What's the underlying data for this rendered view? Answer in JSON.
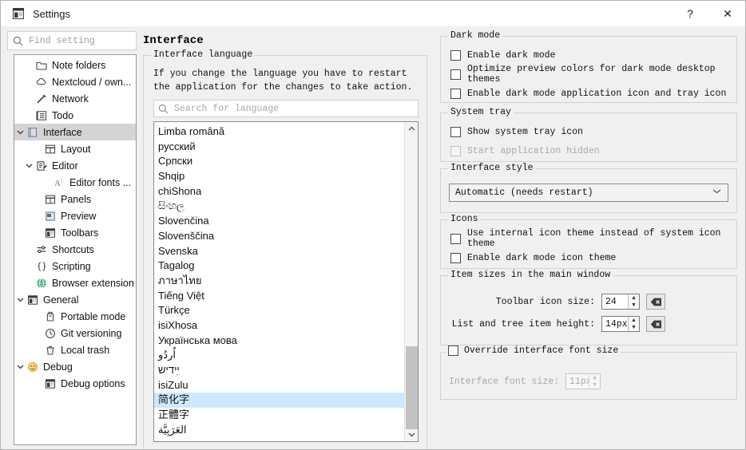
{
  "window": {
    "title": "Settings",
    "app_icon": "app-window-icon",
    "help_label": "?",
    "close_label": "✕"
  },
  "sidebar": {
    "search": {
      "placeholder": "Find setting",
      "value": "",
      "icon": "search-icon"
    },
    "items": [
      {
        "label": "Note folders",
        "icon": "folder-icon",
        "indent": 1,
        "expander": "",
        "selected": false
      },
      {
        "label": "Nextcloud / own...",
        "icon": "cloud-icon",
        "indent": 1,
        "expander": "",
        "selected": false
      },
      {
        "label": "Network",
        "icon": "network-icon",
        "indent": 1,
        "expander": "",
        "selected": false
      },
      {
        "label": "Todo",
        "icon": "todo-list-icon",
        "indent": 1,
        "expander": "",
        "selected": false
      },
      {
        "label": "Interface",
        "icon": "interface-icon",
        "indent": 0,
        "expander": "▾",
        "selected": true
      },
      {
        "label": "Layout",
        "icon": "layout-icon",
        "indent": 2,
        "expander": "",
        "selected": false
      },
      {
        "label": "Editor",
        "icon": "editor-icon",
        "indent": 1,
        "expander": "▾",
        "selected": false
      },
      {
        "label": "Editor fonts ...",
        "icon": "font-icon",
        "indent": 3,
        "expander": "",
        "selected": false
      },
      {
        "label": "Panels",
        "icon": "panels-icon",
        "indent": 2,
        "expander": "",
        "selected": false
      },
      {
        "label": "Preview",
        "icon": "preview-icon",
        "indent": 2,
        "expander": "",
        "selected": false
      },
      {
        "label": "Toolbars",
        "icon": "toolbars-icon",
        "indent": 2,
        "expander": "",
        "selected": false
      },
      {
        "label": "Shortcuts",
        "icon": "sliders-icon",
        "indent": 1,
        "expander": "",
        "selected": false
      },
      {
        "label": "Scripting",
        "icon": "braces-icon",
        "indent": 1,
        "expander": "",
        "selected": false
      },
      {
        "label": "Browser extension",
        "icon": "globe-icon",
        "indent": 1,
        "expander": "",
        "selected": false
      },
      {
        "label": "General",
        "icon": "general-icon",
        "indent": 0,
        "expander": "▾",
        "selected": false
      },
      {
        "label": "Portable mode",
        "icon": "usb-drive-icon",
        "indent": 2,
        "expander": "",
        "selected": false
      },
      {
        "label": "Git versioning",
        "icon": "clock-icon",
        "indent": 2,
        "expander": "",
        "selected": false
      },
      {
        "label": "Local trash",
        "icon": "trash-icon",
        "indent": 2,
        "expander": "",
        "selected": false
      },
      {
        "label": "Debug",
        "icon": "smiley-icon",
        "indent": 0,
        "expander": "▾",
        "selected": false
      },
      {
        "label": "Debug options",
        "icon": "debug-options-icon",
        "indent": 2,
        "expander": "",
        "selected": false
      }
    ]
  },
  "main": {
    "page_title": "Interface",
    "language_group": {
      "title": "Interface language",
      "note": "If you change the language you have to restart the application for the changes to take action.",
      "search": {
        "placeholder": "Search for language",
        "value": "",
        "icon": "search-icon"
      },
      "selected_language": "简化字",
      "scroll": {
        "up_arrow": "⌃",
        "down_arrow": "⌄"
      },
      "languages": [
        "Limba română",
        "русский",
        "Српски",
        "Shqip",
        "chiShona",
        "සිංහල",
        "Slovenčina",
        "Slovenščina",
        "Svenska",
        "Tagalog",
        "ภาษาไทย",
        "Tiếng Việt",
        "Türkçe",
        "isiXhosa",
        "Українська мова",
        "اُردُو",
        "ײִדיש",
        "isiZulu",
        "简化字",
        "正體字",
        "العَرَبِيَّة"
      ]
    }
  },
  "right": {
    "dark_mode": {
      "title": "Dark mode",
      "options": [
        {
          "label": "Enable dark mode",
          "checked": false,
          "enabled": true
        },
        {
          "label": "Optimize preview colors for dark mode desktop themes",
          "checked": false,
          "enabled": true
        },
        {
          "label": "Enable dark mode application icon and tray icon",
          "checked": false,
          "enabled": true
        }
      ]
    },
    "system_tray": {
      "title": "System tray",
      "options": [
        {
          "label": "Show system tray icon",
          "checked": false,
          "enabled": true
        },
        {
          "label": "Start application hidden",
          "checked": false,
          "enabled": false
        }
      ]
    },
    "interface_style": {
      "title": "Interface style",
      "selected": "Automatic (needs restart)",
      "carat": "⌄"
    },
    "icons": {
      "title": "Icons",
      "options": [
        {
          "label": "Use internal icon theme instead of system icon theme",
          "checked": false,
          "enabled": true
        },
        {
          "label": "Enable dark mode icon theme",
          "checked": false,
          "enabled": true
        }
      ]
    },
    "item_sizes": {
      "title": "Item sizes in the main window",
      "toolbar_icon_size": {
        "label": "Toolbar icon size:",
        "value": "24",
        "reset_icon": "reset-backspace-icon"
      },
      "list_item_height": {
        "label": "List and tree item height:",
        "value": "14px",
        "reset_icon": "reset-backspace-icon"
      }
    },
    "font_override": {
      "title": "Override interface font size",
      "checked": false,
      "font_size": {
        "label": "Interface font size:",
        "value": "11px",
        "enabled": false
      }
    }
  }
}
